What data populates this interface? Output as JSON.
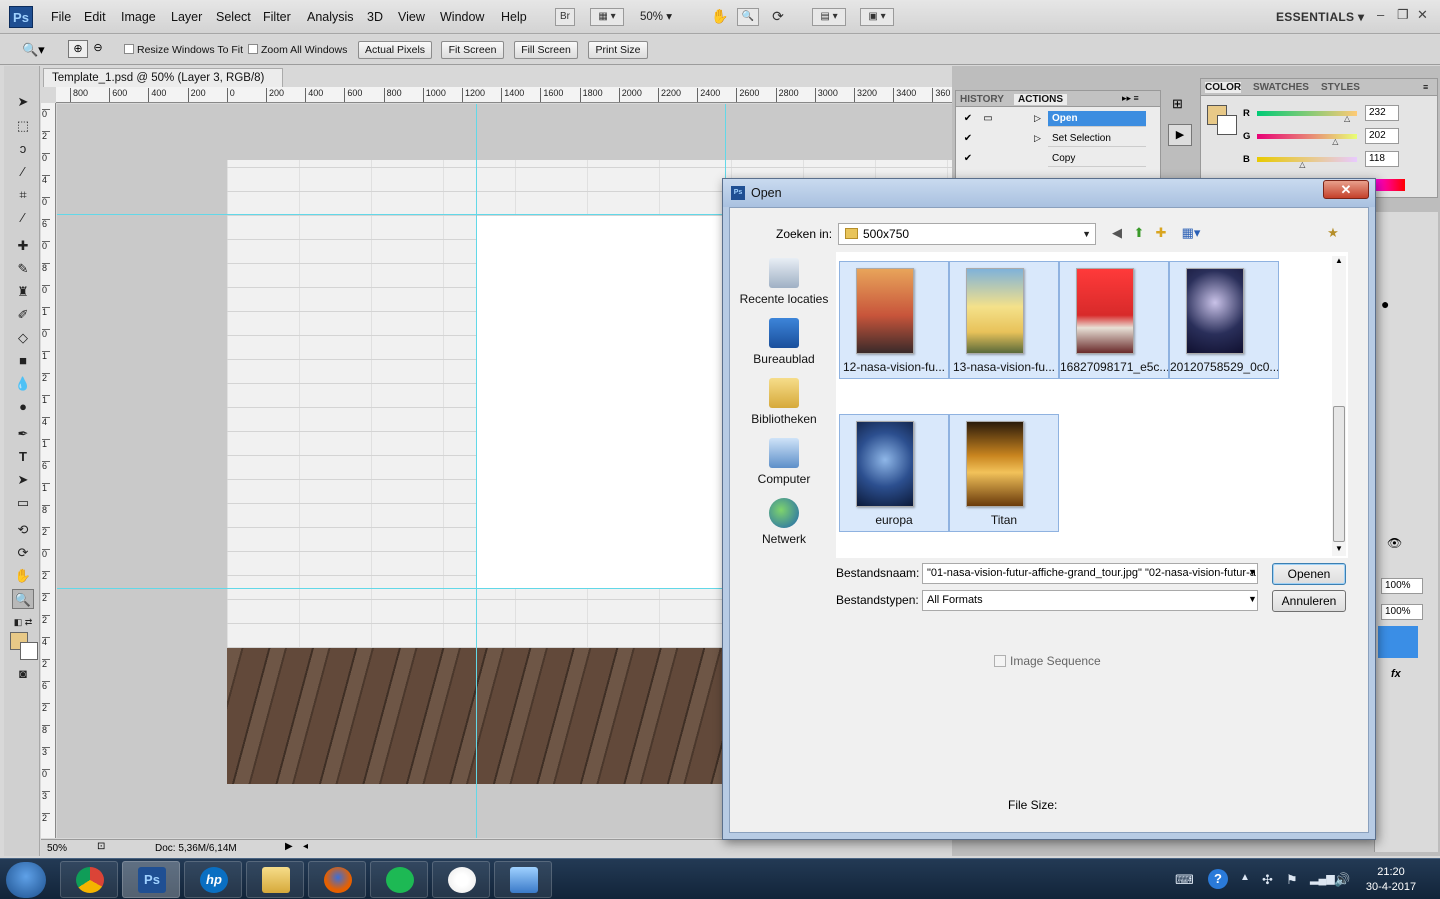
{
  "menubar": {
    "logo": "Ps",
    "items": [
      "File",
      "Edit",
      "Image",
      "Layer",
      "Select",
      "Filter",
      "Analysis",
      "3D",
      "View",
      "Window",
      "Help"
    ],
    "bridge": "Br",
    "zoom": "50%",
    "workspace": "ESSENTIALS"
  },
  "options": {
    "resize_windows": "Resize Windows To Fit",
    "zoom_all": "Zoom All Windows",
    "actual_pixels": "Actual Pixels",
    "fit_screen": "Fit Screen",
    "fill_screen": "Fill Screen",
    "print_size": "Print Size"
  },
  "document": {
    "tab_title": "Template_1.psd @ 50% (Layer 3, RGB/8)",
    "ruler_h": [
      "800",
      "600",
      "400",
      "200",
      "0",
      "200",
      "400",
      "600",
      "800",
      "1000",
      "1200",
      "1400",
      "1600",
      "1800",
      "2000",
      "2200",
      "2400",
      "2600",
      "2800",
      "3000",
      "3200",
      "3400",
      "360"
    ],
    "ruler_v": [
      "0",
      "2",
      "0",
      "4",
      "0",
      "6",
      "0",
      "8",
      "0",
      "1",
      "0",
      "1",
      "2",
      "1",
      "4",
      "1",
      "6",
      "1",
      "8",
      "2",
      "0",
      "2",
      "2",
      "2",
      "4",
      "2",
      "6",
      "2",
      "8",
      "3",
      "0",
      "3",
      "2"
    ],
    "status_zoom": "50%",
    "status_doc": "Doc: 5,36M/6,14M"
  },
  "history_panel": {
    "tabs": [
      "HISTORY",
      "ACTIONS"
    ],
    "actions": [
      "Open",
      "Set Selection",
      "Copy"
    ]
  },
  "color_panel": {
    "tabs": [
      "COLOR",
      "SWATCHES",
      "STYLES"
    ],
    "channels": [
      {
        "label": "R",
        "value": "232"
      },
      {
        "label": "G",
        "value": "202"
      },
      {
        "label": "B",
        "value": "118"
      }
    ],
    "fg_color": "#e8ca76"
  },
  "layers_panel": {
    "opacity": "100%",
    "fill": "100%",
    "fx": "fx"
  },
  "dialog": {
    "title": "Open",
    "close": "✕",
    "look_in_label": "Zoeken in:",
    "look_in_value": "500x750",
    "places": [
      "Recente locaties",
      "Bureaublad",
      "Bibliotheken",
      "Computer",
      "Netwerk"
    ],
    "files": [
      {
        "name": "12-nasa-vision-fu...",
        "color": "#c8553b"
      },
      {
        "name": "13-nasa-vision-fu...",
        "color": "#e8c25a"
      },
      {
        "name": "16827098171_e5c...",
        "color": "#d82a2a"
      },
      {
        "name": "20120758529_0c0...",
        "color": "#2a2f5a"
      },
      {
        "name": "europa",
        "color": "#2c4f8f"
      },
      {
        "name": "Titan",
        "color": "#c9851f"
      }
    ],
    "filename_label": "Bestandsnaam:",
    "filename_value": "\"01-nasa-vision-futur-affiche-grand_tour.jpg\" \"02-nasa-vision-futur-a",
    "filetype_label": "Bestandstypen:",
    "filetype_value": "All Formats",
    "open_button": "Openen",
    "cancel_button": "Annuleren",
    "image_sequence": "Image Sequence",
    "file_size": "File Size:"
  },
  "taskbar": {
    "time": "21:20",
    "date": "30-4-2017",
    "apps": [
      "chrome",
      "photoshop",
      "hp",
      "explorer",
      "firefox",
      "spotify",
      "paint",
      "image-viewer"
    ],
    "ps_label": "Ps",
    "hp_label": "hp"
  }
}
